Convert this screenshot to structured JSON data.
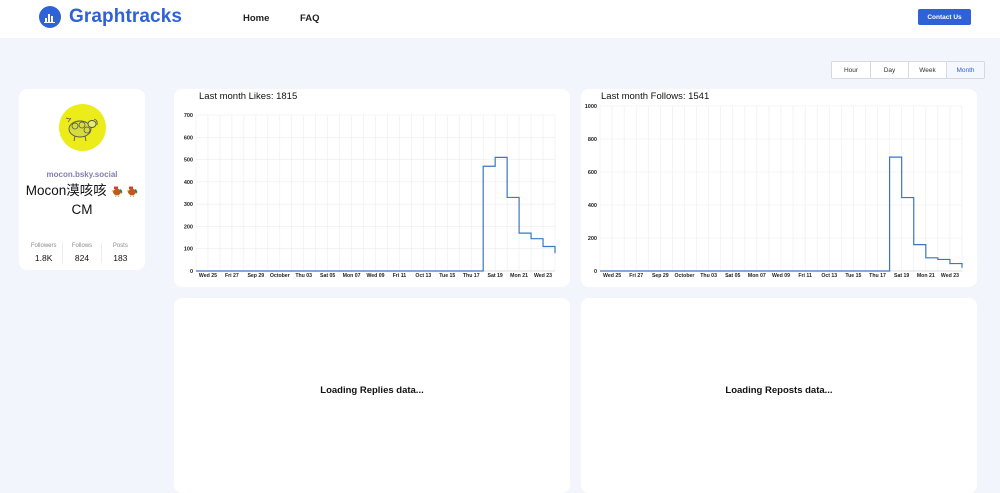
{
  "brand": {
    "name": "Graphtracks",
    "color": "#2f62d6"
  },
  "nav": {
    "home": "Home",
    "faq": "FAQ",
    "contact": "Contact Us"
  },
  "range": {
    "options": [
      "Hour",
      "Day",
      "Week",
      "Month"
    ],
    "selected": "Month"
  },
  "profile": {
    "handle": "mocon.bsky.social",
    "name_line1": "Mocon漠咳咳",
    "name_line2": "CM",
    "emoji": [
      "rooster-emoji",
      "rooster-emoji"
    ],
    "stats": [
      {
        "label": "Followers",
        "value": "1.8K"
      },
      {
        "label": "Follows",
        "value": "824"
      },
      {
        "label": "Posts",
        "value": "183"
      }
    ]
  },
  "chart_data": [
    {
      "type": "line",
      "step": true,
      "title": "Last month Likes: 1815",
      "color": "#3a76c4",
      "xticks": [
        "Wed 25",
        "Fri 27",
        "Sep 29",
        "October",
        "Thu 03",
        "Sat 05",
        "Mon 07",
        "Wed 09",
        "Fri 11",
        "Oct 13",
        "Tue 15",
        "Thu 17",
        "Sat 19",
        "Mon 21",
        "Wed 23"
      ],
      "yticks": [
        0,
        100,
        200,
        300,
        400,
        500,
        600,
        700
      ],
      "ylim": [
        0,
        700
      ],
      "x": [
        "Sep 24",
        "Sep 25",
        "Sep 26",
        "Sep 27",
        "Sep 28",
        "Sep 29",
        "Sep 30",
        "Oct 01",
        "Oct 02",
        "Oct 03",
        "Oct 04",
        "Oct 05",
        "Oct 06",
        "Oct 07",
        "Oct 08",
        "Oct 09",
        "Oct 10",
        "Oct 11",
        "Oct 12",
        "Oct 13",
        "Oct 14",
        "Oct 15",
        "Oct 16",
        "Oct 17",
        "Oct 18",
        "Oct 19",
        "Oct 20",
        "Oct 21",
        "Oct 22",
        "Oct 23",
        "Oct 24"
      ],
      "values": [
        0,
        0,
        0,
        0,
        0,
        0,
        0,
        0,
        0,
        0,
        0,
        0,
        0,
        0,
        0,
        0,
        0,
        0,
        0,
        0,
        0,
        0,
        0,
        0,
        470,
        510,
        330,
        170,
        145,
        110,
        80
      ],
      "grid": true
    },
    {
      "type": "line",
      "step": true,
      "title": "Last month Follows: 1541",
      "color": "#3a76c4",
      "xticks": [
        "Wed 25",
        "Fri 27",
        "Sep 29",
        "October",
        "Thu 03",
        "Sat 05",
        "Mon 07",
        "Wed 09",
        "Fri 11",
        "Oct 13",
        "Tue 15",
        "Thu 17",
        "Sat 19",
        "Mon 21",
        "Wed 23"
      ],
      "yticks": [
        0,
        200,
        400,
        600,
        800,
        1000
      ],
      "ylim": [
        0,
        1000
      ],
      "x": [
        "Sep 24",
        "Sep 25",
        "Sep 26",
        "Sep 27",
        "Sep 28",
        "Sep 29",
        "Sep 30",
        "Oct 01",
        "Oct 02",
        "Oct 03",
        "Oct 04",
        "Oct 05",
        "Oct 06",
        "Oct 07",
        "Oct 08",
        "Oct 09",
        "Oct 10",
        "Oct 11",
        "Oct 12",
        "Oct 13",
        "Oct 14",
        "Oct 15",
        "Oct 16",
        "Oct 17",
        "Oct 18",
        "Oct 19",
        "Oct 20",
        "Oct 21",
        "Oct 22",
        "Oct 23",
        "Oct 24"
      ],
      "values": [
        0,
        0,
        0,
        0,
        0,
        0,
        0,
        0,
        0,
        0,
        0,
        0,
        0,
        0,
        0,
        0,
        0,
        0,
        0,
        0,
        0,
        0,
        0,
        0,
        690,
        445,
        160,
        80,
        70,
        45,
        20
      ],
      "grid": true
    }
  ],
  "loading": {
    "replies": "Loading Replies data...",
    "reposts": "Loading Reposts data..."
  }
}
